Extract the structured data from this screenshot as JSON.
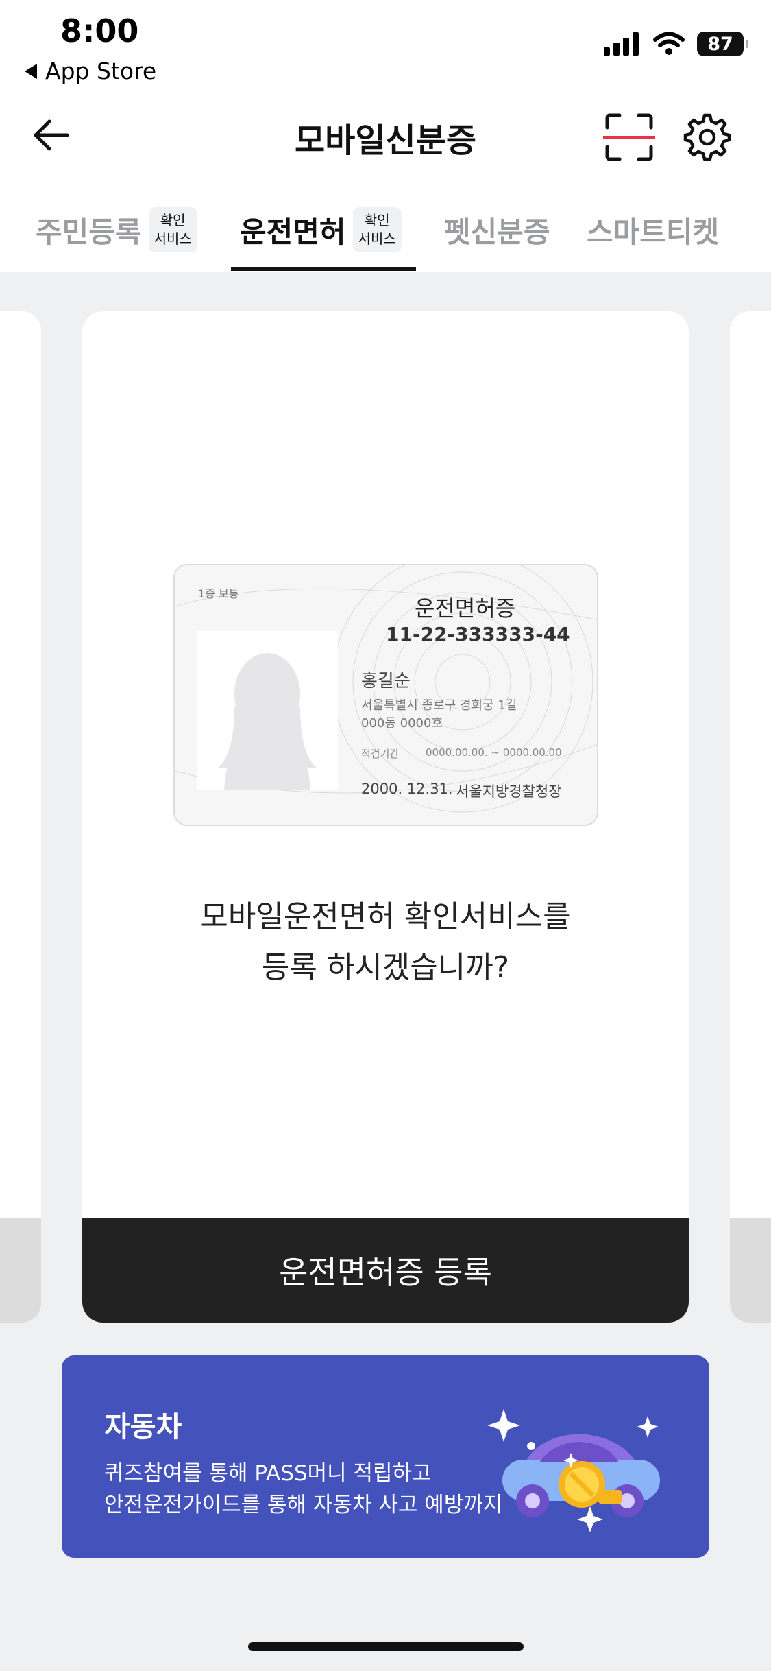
{
  "status_bar": {
    "time": "8:00",
    "back_app": "App Store",
    "battery": "87"
  },
  "header": {
    "title": "모바일신분증"
  },
  "tabs": [
    {
      "label": "주민등록",
      "badge_line1": "확인",
      "badge_line2": "서비스",
      "active": false
    },
    {
      "label": "운전면허",
      "badge_line1": "확인",
      "badge_line2": "서비스",
      "active": true
    },
    {
      "label": "펫신분증",
      "active": false
    },
    {
      "label": "스마트티켓",
      "active": false
    }
  ],
  "license_card": {
    "type": "1종 보통",
    "title": "운전면허증",
    "number": "11-22-333333-44",
    "name": "홍길순",
    "address_line1": "서울특별시 종로구 경희궁 1길",
    "address_line2": "000동 0000호",
    "period_label": "적검기간",
    "period": "0000.00.00. ~ 0000.00.00",
    "issue_date": "2000. 12.31.",
    "issuer": "서울지방경찰청장"
  },
  "question": {
    "line1": "모바일운전면허 확인서비스를",
    "line2": "등록 하시겠습니까?"
  },
  "register_button": "운전면허증 등록",
  "banner": {
    "title": "자동차",
    "line1": "퀴즈참여를 통해 PASS머니 적립하고",
    "line2": "안전운전가이드를 통해 자동차 사고 예방까지",
    "color": "#4452bc"
  }
}
